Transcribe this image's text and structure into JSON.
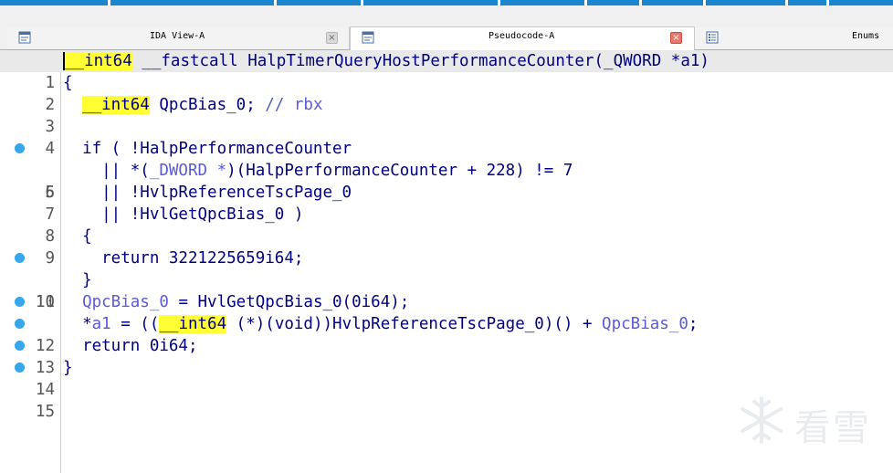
{
  "tabs": [
    {
      "label": "IDA View-A",
      "close": "×",
      "active": false
    },
    {
      "label": "Pseudocode-A",
      "close": "×",
      "active": true
    },
    {
      "label": "Enums",
      "active": false
    }
  ],
  "code": {
    "lines": [
      {
        "n": "1"
      },
      {
        "n": "2",
        "t": "{"
      },
      {
        "n": "3",
        "ty": "__int64",
        "rest": " QpcBias_0; ",
        "cm": "// ",
        "reg": "rbx"
      },
      {
        "n": "4"
      },
      {
        "n": "5",
        "t": "  if ( !HalpPerformanceCounter"
      },
      {
        "n": "6",
        "a": "    || *(",
        "b": "_DWORD *",
        "c": ")(HalpPerformanceCounter + 228) != 7"
      },
      {
        "n": "7",
        "t": "    || !HvlpReferenceTscPage_0"
      },
      {
        "n": "8",
        "t": "    || !HvlGetQpcBias_0 )"
      },
      {
        "n": "9",
        "t": "  {"
      },
      {
        "n": "10",
        "t": "    return 3221225659i64;"
      },
      {
        "n": "11",
        "t": "  }"
      },
      {
        "n": "12",
        "v": "QpcBias_0",
        "t": " = HvlGetQpcBias_0(0i64);"
      },
      {
        "n": "13",
        "a": "  *",
        "v": "a1",
        "b": " = ((",
        "ty": "__int64",
        "c": " (*)(void))HvlpReferenceTscPage_0)() + ",
        "v2": "QpcBias_0",
        "d": ";"
      },
      {
        "n": "14",
        "t": "  return 0i64;"
      },
      {
        "n": "15",
        "t": "}"
      }
    ],
    "l1": {
      "ty": "__int64",
      "mid": " __fastcall HalpTimerQueryHostPerformanceCounter(",
      "argty": "_QWORD",
      "arg": " *a1)"
    }
  },
  "watermark": {
    "text": "看雪"
  }
}
